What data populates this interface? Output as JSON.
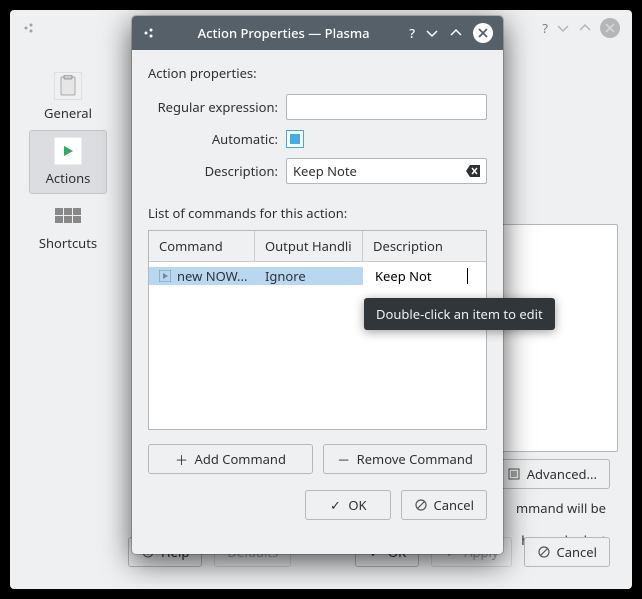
{
  "bg": {
    "sidebar": {
      "general": "General",
      "actions": "Actions",
      "shortcuts": "Shortcuts"
    },
    "advanced": "Advanced...",
    "hint1": "mmand will be",
    "hint2": "have a look at",
    "buttons": {
      "help": "Help",
      "defaults": "Defaults",
      "ok": "OK",
      "apply": "Apply",
      "cancel": "Cancel"
    }
  },
  "modal": {
    "title": "Action Properties — Plasma",
    "heading": "Action properties:",
    "regex_label": "Regular expression:",
    "regex_value": "",
    "auto_label": "Automatic:",
    "auto_checked": true,
    "desc_label": "Description:",
    "desc_value": "Keep Note",
    "list_label": "List of commands for this action:",
    "cols": {
      "c1": "Command",
      "c2": "Output Handling",
      "c3": "Description"
    },
    "cols_display": {
      "c2": "Output Handli"
    },
    "row": {
      "cmd": "new NOW...",
      "out": "Ignore",
      "desc": "Keep Not"
    },
    "add": "Add Command",
    "remove": "Remove Command",
    "ok": "OK",
    "cancel": "Cancel"
  },
  "tooltip": "Double-click an item to edit"
}
